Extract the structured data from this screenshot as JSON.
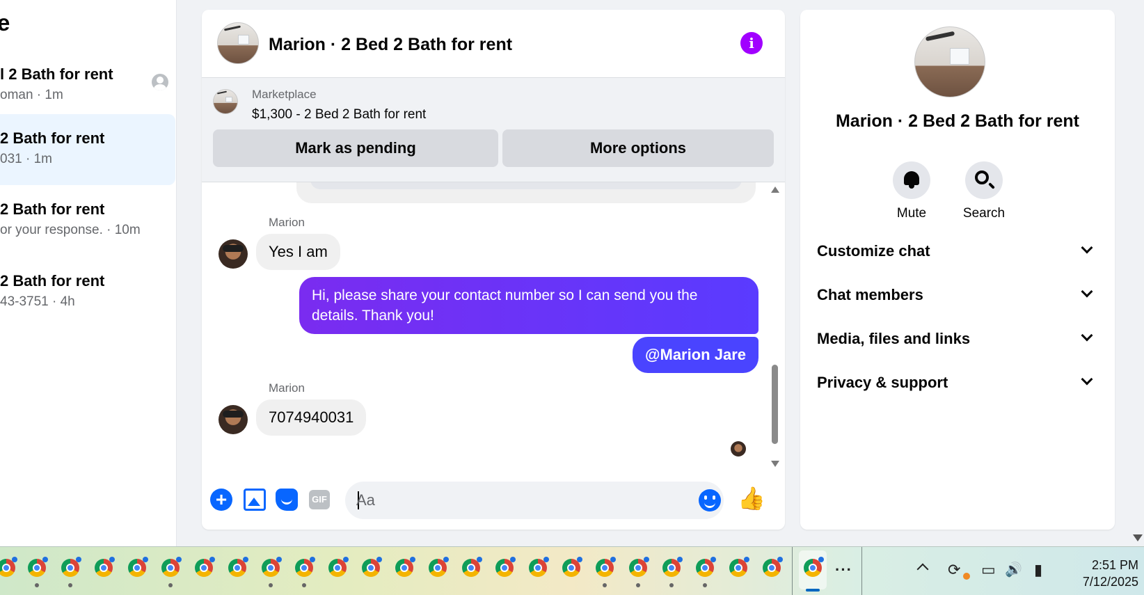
{
  "left_panel": {
    "title_fragment": "e",
    "conversations": [
      {
        "title": "l 2 Bath for rent",
        "subtitle": "oman · 1m"
      },
      {
        "title": " 2 Bath for rent",
        "subtitle": "031 · 1m"
      },
      {
        "title": "2 Bath for rent",
        "subtitle": "or your response. · 10m"
      },
      {
        "title": " 2 Bath for rent",
        "subtitle": "43-3751 · 4h"
      }
    ]
  },
  "chat": {
    "header_title": "Marion · 2 Bed 2 Bath for rent",
    "info_glyph": "i",
    "marketplace": {
      "label": "Marketplace",
      "item": "$1,300 - 2 Bed 2 Bath for rent",
      "mark_pending_label": "Mark as pending",
      "more_options_label": "More options"
    },
    "messages": [
      {
        "sender": "Marion",
        "text": "Yes I am",
        "direction": "in"
      },
      {
        "text": "Hi, please share your contact number so I can send you the details. Thank you!",
        "direction": "out"
      },
      {
        "text": "@Marion Jare",
        "direction": "out"
      },
      {
        "sender": "Marion",
        "text": "7074940031",
        "direction": "in"
      }
    ],
    "composer": {
      "placeholder": "Aa",
      "gif_label": "GIF",
      "plus_glyph": "+",
      "like_glyph": "👍"
    }
  },
  "right_panel": {
    "title": "Marion · 2 Bed 2 Bath for rent",
    "actions": [
      {
        "label": "Mute",
        "icon": "bell-icon"
      },
      {
        "label": "Search",
        "icon": "search-icon"
      }
    ],
    "sections": [
      {
        "label": "Customize chat"
      },
      {
        "label": "Chat members"
      },
      {
        "label": "Media, files and links"
      },
      {
        "label": "Privacy & support"
      }
    ]
  },
  "taskbar": {
    "more_glyph": "···",
    "tray_glyphs": {
      "sync": "⟳",
      "display": "▭",
      "volume": "🔊",
      "battery": "▮"
    },
    "time": "2:51 PM",
    "date": "7/12/2025"
  },
  "colors": {
    "accent": "#0866ff",
    "info": "#a100ff",
    "outgoing_bubble_start": "#7a2cf0",
    "outgoing_bubble_end": "#5a3bff"
  }
}
